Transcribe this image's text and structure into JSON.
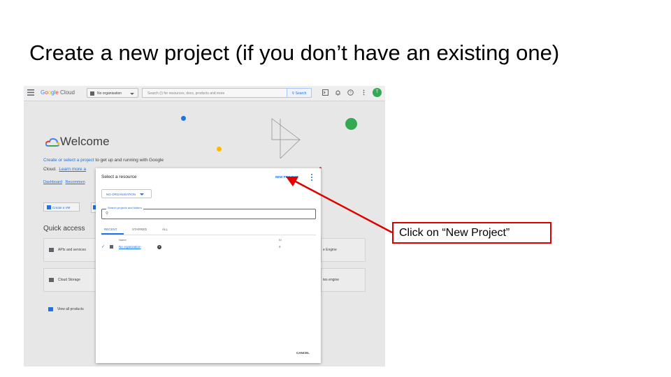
{
  "slide": {
    "title": "Create a new project (if you don’t have an existing one)"
  },
  "topbar": {
    "logo_text": "Google Cloud",
    "org_selector": "No organisation",
    "search_placeholder": "Search (/) for resources, docs, products and more",
    "search_button": "Search",
    "avatar_letter": "T"
  },
  "welcome": {
    "heading": "Welcome",
    "intro_link": "Create or select a project",
    "intro_text": " to get up and running with Google",
    "intro_line2_prefix": "Cloud.",
    "learn_more": "Learn more a",
    "tabs": [
      "Dashboard",
      "Recommen"
    ],
    "create_vm": "Create a VM",
    "quick_access_title": "Quick access",
    "cards_left": [
      "APIs and services",
      "Cloud Storage",
      "View all products"
    ],
    "cards_right": [
      "e Engine",
      "tes engine"
    ]
  },
  "dialog": {
    "title": "Select a resource",
    "new_project": "NEW PROJECT",
    "org_button": "NO ORGANISATION",
    "search_label": "Search projects and folders",
    "tabs": [
      "RECENT",
      "STARRED",
      "ALL"
    ],
    "col_name": "Name",
    "col_id": "ID",
    "row": {
      "name": "No organisation",
      "id": "0"
    },
    "cancel": "CANCEL"
  },
  "callout": {
    "text": "Click on “New Project”",
    "color": "#d90000"
  },
  "colors": {
    "accent": "#1a73e8",
    "google_green": "#34a853",
    "google_yellow": "#fbbc04",
    "google_red": "#ea4335"
  }
}
